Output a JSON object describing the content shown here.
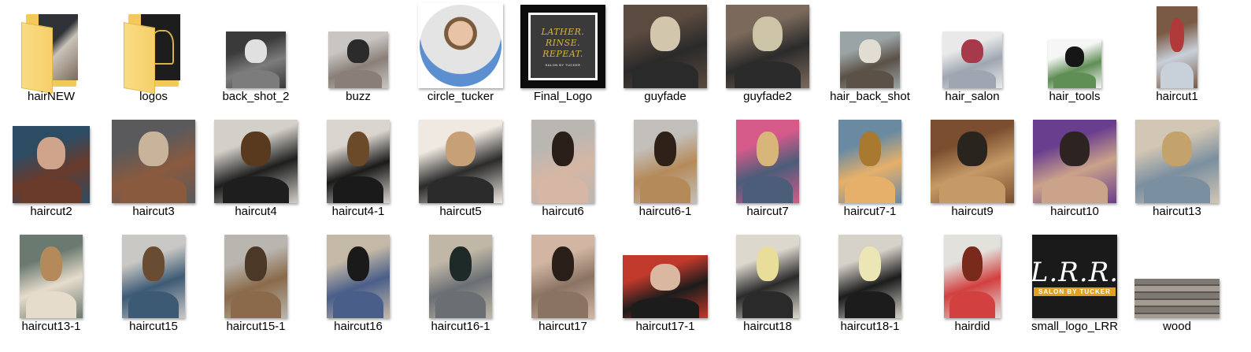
{
  "files": [
    {
      "name": "hairNEW",
      "kind": "folder",
      "colors": [
        "#2f3237",
        "#c9c3b8",
        "#7a6a5a"
      ]
    },
    {
      "name": "logos",
      "kind": "folder-logo",
      "colors": [
        "#1d1d1d",
        "#d6b24a"
      ]
    },
    {
      "name": "back_shot_2",
      "kind": "photo",
      "colors": [
        "#3a3a3a",
        "#e0e0e0",
        "#7c7c7c"
      ]
    },
    {
      "name": "buzz",
      "kind": "photo",
      "colors": [
        "#c8c5c2",
        "#2b2b2b",
        "#8a7f78"
      ]
    },
    {
      "name": "circle_tucker",
      "kind": "circle",
      "colors": [
        "#5b8fcf",
        "#e8c3a6",
        "#7a5b3c"
      ]
    },
    {
      "name": "Final_Logo",
      "kind": "logo-box",
      "logo_text": [
        "LATHER.",
        "RINSE.",
        "REPEAT."
      ],
      "logo_sub": "SALON BY TUCKER",
      "colors": [
        "#0c0c0c",
        "#3a3a3a",
        "#d8b33b"
      ]
    },
    {
      "name": "guyfade",
      "kind": "photo",
      "colors": [
        "#5a4a3f",
        "#d2c7ad",
        "#2a2a2a"
      ]
    },
    {
      "name": "guyfade2",
      "kind": "photo",
      "colors": [
        "#7b6a5c",
        "#cdc3a6",
        "#2b2b2b"
      ]
    },
    {
      "name": "hair_back_shot",
      "kind": "photo",
      "colors": [
        "#9aa3a5",
        "#e2ddd3",
        "#5b5146"
      ]
    },
    {
      "name": "hair_salon",
      "kind": "photo",
      "colors": [
        "#e9e9ea",
        "#a63a4a",
        "#9fa6b1"
      ]
    },
    {
      "name": "hair_tools",
      "kind": "photo",
      "colors": [
        "#f6f6f6",
        "#161616",
        "#5f8f55"
      ]
    },
    {
      "name": "haircut1",
      "kind": "photo",
      "colors": [
        "#7a5a44",
        "#b03a3a",
        "#c8d0da"
      ]
    },
    {
      "name": "haircut2",
      "kind": "photo",
      "colors": [
        "#2c4c64",
        "#d0a48a",
        "#6a3a2a"
      ]
    },
    {
      "name": "haircut3",
      "kind": "photo",
      "colors": [
        "#5a5a5c",
        "#c7b49a",
        "#8a5a3e"
      ]
    },
    {
      "name": "haircut4",
      "kind": "photo",
      "colors": [
        "#d3cfc9",
        "#5a3a1e",
        "#1e1e1e"
      ]
    },
    {
      "name": "haircut4-1",
      "kind": "photo",
      "colors": [
        "#d9d4cd",
        "#6b4a2a",
        "#1a1a1a"
      ]
    },
    {
      "name": "haircut5",
      "kind": "photo",
      "colors": [
        "#efe9e1",
        "#c6a178",
        "#2b2b2b"
      ]
    },
    {
      "name": "haircut6",
      "kind": "photo",
      "colors": [
        "#bab7b3",
        "#2a1e18",
        "#d6b6a4"
      ]
    },
    {
      "name": "haircut6-1",
      "kind": "photo",
      "colors": [
        "#c3c0bb",
        "#2d2118",
        "#b58a5a"
      ]
    },
    {
      "name": "haircut7",
      "kind": "photo",
      "colors": [
        "#d55a8a",
        "#d8b579",
        "#4b5d79"
      ]
    },
    {
      "name": "haircut7-1",
      "kind": "photo",
      "colors": [
        "#6a8aa2",
        "#a8792e",
        "#e6b06a"
      ]
    },
    {
      "name": "haircut9",
      "kind": "photo",
      "colors": [
        "#7a4e2e",
        "#2a241e",
        "#c69a66"
      ]
    },
    {
      "name": "haircut10",
      "kind": "photo",
      "colors": [
        "#6a3e8f",
        "#2d2320",
        "#cba38a"
      ]
    },
    {
      "name": "haircut13",
      "kind": "photo",
      "colors": [
        "#d2c6b4",
        "#c4a26c",
        "#7a8fa0"
      ]
    },
    {
      "name": "haircut13-1",
      "kind": "photo",
      "colors": [
        "#6b7a70",
        "#b48a5a",
        "#e6dccc"
      ]
    },
    {
      "name": "haircut15",
      "kind": "photo",
      "colors": [
        "#c9c8c4",
        "#6a4c32",
        "#3d5a75"
      ]
    },
    {
      "name": "haircut15-1",
      "kind": "photo",
      "colors": [
        "#b9b6b0",
        "#4b3826",
        "#8a6a4a"
      ]
    },
    {
      "name": "haircut16",
      "kind": "photo",
      "colors": [
        "#c4b9a6",
        "#1a1a1a",
        "#4a5e8a"
      ]
    },
    {
      "name": "haircut16-1",
      "kind": "photo",
      "colors": [
        "#c0b7a6",
        "#1e2a28",
        "#6a6f74"
      ]
    },
    {
      "name": "haircut17",
      "kind": "photo",
      "colors": [
        "#d2b6a3",
        "#2a1f18",
        "#8a7363"
      ]
    },
    {
      "name": "haircut17-1",
      "kind": "photo",
      "colors": [
        "#c0392b",
        "#d9b7a0",
        "#1c1c1c"
      ]
    },
    {
      "name": "haircut18",
      "kind": "photo",
      "colors": [
        "#dcd8ce",
        "#e8de9a",
        "#2a2a2a"
      ]
    },
    {
      "name": "haircut18-1",
      "kind": "photo",
      "colors": [
        "#d6d2ca",
        "#ece6b6",
        "#1c1c1c"
      ]
    },
    {
      "name": "hairdid",
      "kind": "photo",
      "colors": [
        "#e3e1dc",
        "#7a2a1a",
        "#d24040"
      ]
    },
    {
      "name": "small_logo_LRR",
      "kind": "logo-lrr",
      "logo_text": "L.R.R.",
      "logo_sub": "SALON BY TUCKER",
      "colors": [
        "#1a1a1a",
        "#ffffff",
        "#e2a021"
      ]
    },
    {
      "name": "wood",
      "kind": "wood",
      "colors": [
        "#7e7973",
        "#5a5550",
        "#a49c92"
      ]
    }
  ]
}
